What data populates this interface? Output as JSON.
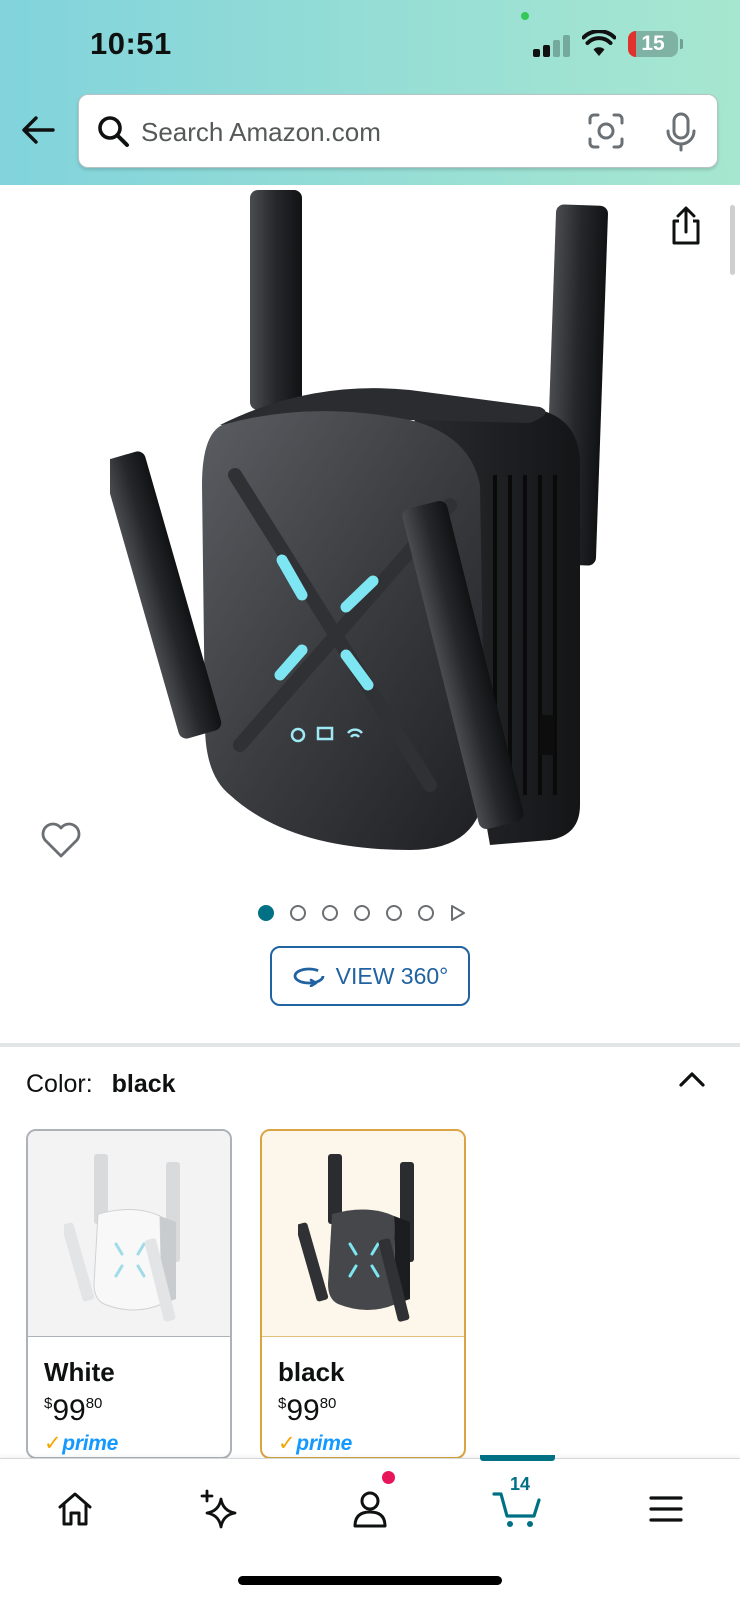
{
  "status_bar": {
    "time": "10:51",
    "battery": "15"
  },
  "header": {
    "search": {
      "placeholder": "Search Amazon.com"
    },
    "icons": [
      "back-arrow-icon",
      "search-icon",
      "camera-scan-icon",
      "microphone-icon"
    ]
  },
  "gallery": {
    "image_count": 6,
    "active_index": 0,
    "view360_label": "VIEW 360°",
    "icons": [
      "share-icon",
      "heart-icon",
      "play-icon",
      "rotate-360-icon"
    ]
  },
  "color_selector": {
    "label": "Color:",
    "selected": "black",
    "options": [
      {
        "name": "White",
        "price_symbol": "$",
        "price_whole": "99",
        "price_fraction": "80",
        "prime": "prime",
        "selected": false
      },
      {
        "name": "black",
        "price_symbol": "$",
        "price_whole": "99",
        "price_fraction": "80",
        "prime": "prime",
        "selected": true
      }
    ]
  },
  "bottom_nav": {
    "items": [
      "home-icon",
      "sparkle-icon",
      "account-icon",
      "cart-icon",
      "menu-icon"
    ],
    "cart_count": "14",
    "active": "cart"
  },
  "colors": {
    "accent_teal": "#007185",
    "link_blue": "#2162a1",
    "prime_blue": "#1399ff",
    "selected_border": "#d9a441",
    "notification": "#e7165b"
  }
}
